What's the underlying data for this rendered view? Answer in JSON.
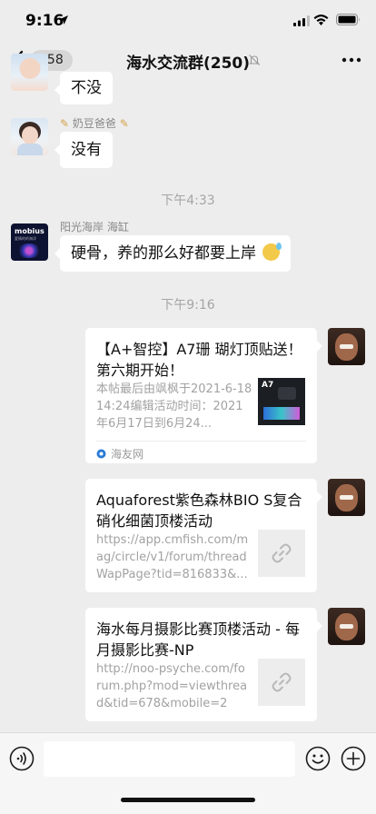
{
  "status_bar": {
    "time": "9:16"
  },
  "nav": {
    "unread_count": "758",
    "title": "海水交流群(250)"
  },
  "messages": {
    "m1": {
      "text": "不没"
    },
    "m2": {
      "sender": "奶豆爸爸",
      "text": "没有"
    },
    "ts1": "下午4:33",
    "m3": {
      "sender": "阳光海岸 海缸",
      "avatar_text": "mobius",
      "avatar_subtext": "愛情的的海洋",
      "text": "硬骨，养的那么好都要上岸"
    },
    "ts2": "下午9:16"
  },
  "cards": [
    {
      "title": "【A+智控】A7珊 瑚灯顶贴送！第六期开始！",
      "description": "本帖最后由飒枫于2021-6-1814:24编辑活动时间：2021年6月17日到6月24...",
      "thumb_label": "A7",
      "source": "海友网"
    },
    {
      "title": "Aquaforest紫色森林BIO S复合硝化细菌顶楼活动",
      "description": "https://app.cmfish.com/mag/circle/v1/forum/threadWapPage?tid=816833&..."
    },
    {
      "title": "海水每月摄影比赛顶楼活动 - 每月摄影比赛-NP",
      "description": "http://noo-psyche.com/forum.php?mod=viewthread&tid=678&mobile=2"
    }
  ],
  "icons": {
    "back": "chevron-left-icon",
    "mute": "bell-slash-icon",
    "more": "ellipsis-icon",
    "link": "link-icon",
    "voice": "voice-icon",
    "emoji": "emoji-icon",
    "plus": "plus-icon"
  },
  "colors": {
    "background": "#ededed",
    "bubble": "#ffffff",
    "muted_text": "#a2a2a2"
  }
}
